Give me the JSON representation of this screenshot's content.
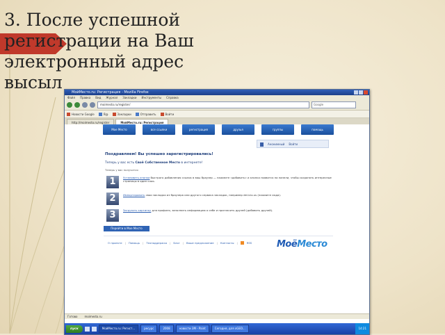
{
  "slide": {
    "title": "3. После успешной регистрации на Ваш электронный адрес высыл"
  },
  "browser": {
    "window_title": "МойМесто.ru: Регистрация - Mozilla Firefox",
    "menu": [
      "Файл",
      "Правка",
      "Вид",
      "Журнал",
      "Закладки",
      "Инструменты",
      "Справка"
    ],
    "url": "moimesto.ru/register/",
    "search_placeholder": "Google",
    "bookmarks": [
      {
        "label": "Новости Google",
        "icon": "news-icon"
      },
      {
        "label": "Я@",
        "icon": "mail-icon"
      },
      {
        "label": "Закладки",
        "icon": "star-icon"
      },
      {
        "label": "Отправить",
        "icon": "send-icon"
      },
      {
        "label": "Войти",
        "icon": "login-icon"
      }
    ],
    "tabs": [
      {
        "label": "http://moimesto.ru/register",
        "active": false
      },
      {
        "label": "МойМесто.ru: Регистрация",
        "active": true
      }
    ],
    "page": {
      "nav": [
        "Мое Место",
        "все ссылки",
        "регистрация",
        "друзья",
        "группы",
        "помощь"
      ],
      "userbox": {
        "name": "Анонимный",
        "link": "Войти"
      },
      "congrats": "Поздравляем! Вы успешно зарегистрировались!",
      "subline_prefix": "Теперь у вас есть",
      "subline_bold": "Своё Собственное Место",
      "subline_suffix": "в интернете!",
      "can_do": "Теперь у вас получится:",
      "steps": [
        {
          "num": "1",
          "link": "Установить кнопки",
          "text": "быстрого добавления ссылок в ваш браузер — нажмите «добавить» и кнопка появится на панели, чтобы сохранять интересные страницы в один клик."
        },
        {
          "num": "2",
          "link": "Импортировать",
          "text": "свои закладки из браузера или другого сервиса закладок, например del.icio.us (нажмите сюда)."
        },
        {
          "num": "3",
          "link": "Загрузить картинку",
          "text": "для профиля, заполнить информацию о себе и пригласить друзей (добавить друзей)."
        }
      ],
      "go_button": "Перейти в Мое Место",
      "footer": [
        "О проекте",
        "Помощь",
        "Техподдержка",
        "Блог",
        "Ваше предложение",
        "Контакты",
        "RSS"
      ],
      "brand_main": "Моё",
      "brand_second": "Место"
    },
    "statusbar": [
      "Готово",
      "moimesto.ru"
    ]
  },
  "taskbar": {
    "start_label": "пуск",
    "items": [
      {
        "label": "МойМесто.ru: Регист...",
        "active": true
      },
      {
        "label": "ресурс",
        "active": false
      },
      {
        "label": "2008",
        "active": false
      },
      {
        "label": "новости 3М - Paint",
        "active": false
      },
      {
        "label": "Сегодня, для xGEO...",
        "active": false
      }
    ],
    "tray": "14:21"
  }
}
